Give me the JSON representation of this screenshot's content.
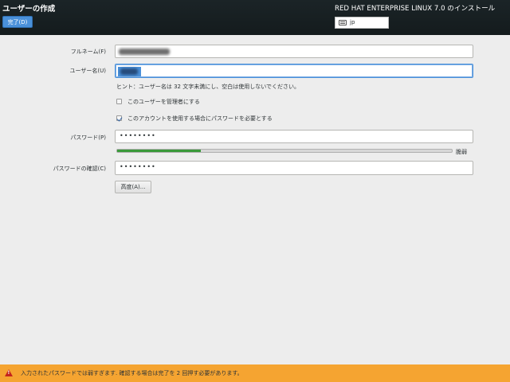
{
  "header": {
    "title": "ユーザーの作成",
    "done_label": "完了(D)",
    "product": "RED HAT ENTERPRISE LINUX 7.0 のインストール",
    "keyboard_layout": "jp"
  },
  "form": {
    "fullname_label": "フルネーム(F)",
    "username_label": "ユーザー名(U)",
    "hint": "ヒント：ユーザー名は 32 文字未満にし、空白は使用しないでください。",
    "admin_label": "このユーザーを管理者にする",
    "admin_checked": false,
    "require_password_label": "このアカウントを使用する場合にパスワードを必要とする",
    "require_password_checked": true,
    "password_label": "パスワード(P)",
    "password_value": "••••••••",
    "strength_fraction": 0.25,
    "strength_label": "脆弱",
    "confirm_label": "パスワードの確認(C)",
    "confirm_value": "••••••••",
    "advanced_label": "高度(A)..."
  },
  "warning": {
    "text": "入力されたパスワードでは弱すぎます. 確認する場合は完了を 2 回押す必要があります。",
    "color": "#f5a431"
  }
}
